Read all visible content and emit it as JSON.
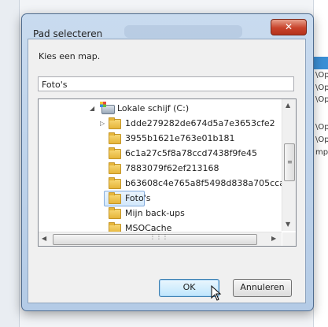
{
  "background": {
    "lines": [
      "\\Op",
      "\\Op",
      "\\Op",
      "\\Op",
      "\\Op",
      "mp"
    ]
  },
  "dialog": {
    "title": "Pad selecteren",
    "close_glyph": "✕",
    "prompt": "Kies een map.",
    "path_value": "Foto's",
    "tree": {
      "drive_label": "Lokale schijf (C:)",
      "folders": [
        "1dde279282de674d5a7e3653cfe2",
        "3955b1621e763e01b181",
        "6c1a27c5f8a78ccd7438f9fe45",
        "7883079f62ef213168",
        "b63608c4e765a8f5498d838a705cca",
        "Foto's",
        "Mijn back-ups",
        "MSOCache"
      ],
      "selected": "Foto's"
    },
    "ok_label": "OK",
    "cancel_label": "Annuleren"
  },
  "colors": {
    "accent": "#3b8fd6",
    "close": "#c8432b",
    "folder": "#e6b53a"
  }
}
